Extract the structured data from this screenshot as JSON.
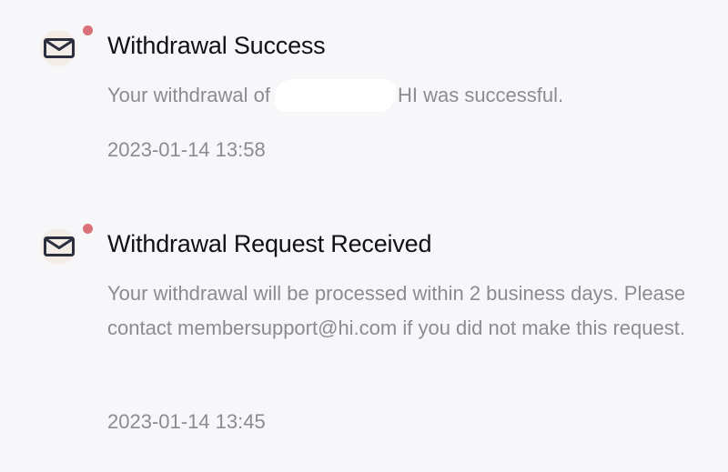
{
  "notifications": [
    {
      "icon": "mail-icon",
      "unread": true,
      "title": "Withdrawal Success",
      "message_before": "Your withdrawal of",
      "message_after": "HI was successful.",
      "timestamp": "2023-01-14 13:58"
    },
    {
      "icon": "mail-icon",
      "unread": true,
      "title": "Withdrawal Request Received",
      "message": "Your withdrawal will be processed within 2 business days. Please contact membersupport@hi.com if you did not make this request.",
      "timestamp": "2023-01-14 13:45"
    }
  ],
  "colors": {
    "background": "#f7f7f9",
    "icon_bg": "#f4ece6",
    "icon_stroke": "#2b2f3e",
    "unread_dot": "#d9707a",
    "title": "#111114",
    "secondary_text": "#8b8b91"
  }
}
